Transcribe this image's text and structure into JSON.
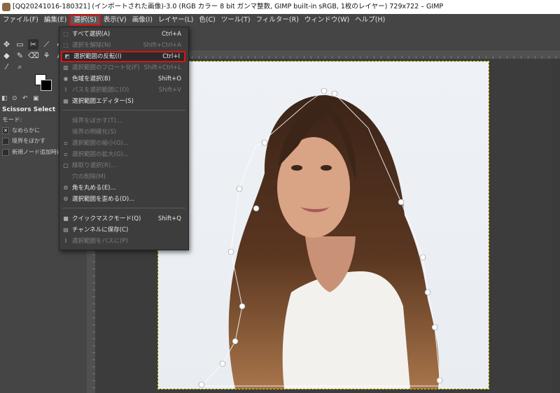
{
  "window": {
    "title": "[QQ20241016-180321] (インポートされた画像)-3.0 (RGB カラー 8 bit ガンマ整数, GIMP built-in sRGB, 1枚のレイヤー) 729x722 – GIMP"
  },
  "menubar": [
    {
      "label": "ファイル(F)"
    },
    {
      "label": "編集(E)"
    },
    {
      "label": "選択(S)"
    },
    {
      "label": "表示(V)"
    },
    {
      "label": "画像(I)"
    },
    {
      "label": "レイヤー(L)"
    },
    {
      "label": "色(C)"
    },
    {
      "label": "ツール(T)"
    },
    {
      "label": "フィルター(R)"
    },
    {
      "label": "ウィンドウ(W)"
    },
    {
      "label": "ヘルプ(H)"
    }
  ],
  "select_menu": {
    "items": [
      {
        "label": "すべて選択(A)",
        "shortcut": "Ctrl+A",
        "enabled": true,
        "icon": "select-all-icon"
      },
      {
        "label": "選択を解除(N)",
        "shortcut": "Shift+Ctrl+A",
        "enabled": false,
        "icon": "select-none-icon"
      },
      {
        "label": "選択範囲の反転(I)",
        "shortcut": "Ctrl+I",
        "enabled": true,
        "highlighted": true,
        "icon": "invert-selection-icon"
      },
      {
        "label": "選択範囲のフロート化(F)",
        "shortcut": "Shift+Ctrl+L",
        "enabled": false,
        "icon": "float-selection-icon"
      },
      {
        "label": "色域を選択(B)",
        "shortcut": "Shift+O",
        "enabled": true,
        "icon": "select-by-color-icon"
      },
      {
        "label": "パスを選択範囲に(O)",
        "shortcut": "Shift+V",
        "enabled": false,
        "icon": "path-to-selection-icon"
      },
      {
        "label": "選択範囲エディター(S)",
        "shortcut": "",
        "enabled": true,
        "icon": "selection-editor-icon"
      },
      {
        "label": "境界をぼかす(T)...",
        "shortcut": "",
        "enabled": false,
        "icon": ""
      },
      {
        "label": "境界の明確化(S)",
        "shortcut": "",
        "enabled": false,
        "icon": ""
      },
      {
        "label": "選択範囲の縮小(G)...",
        "shortcut": "",
        "enabled": false,
        "icon": "shrink-icon"
      },
      {
        "label": "選択範囲の拡大(G)...",
        "shortcut": "",
        "enabled": false,
        "icon": "grow-icon"
      },
      {
        "label": "縁取り選択(R)...",
        "shortcut": "",
        "enabled": false,
        "icon": "border-icon"
      },
      {
        "label": "穴の削除(M)",
        "shortcut": "",
        "enabled": false,
        "icon": ""
      },
      {
        "label": "角を丸める(E)...",
        "shortcut": "",
        "enabled": true,
        "icon": "round-corners-icon"
      },
      {
        "label": "選択範囲を歪める(D)...",
        "shortcut": "",
        "enabled": true,
        "icon": "distort-icon"
      },
      {
        "label": "クイックマスクモード(Q)",
        "shortcut": "Shift+Q",
        "enabled": true,
        "icon": "quick-mask-icon"
      },
      {
        "label": "チャンネルに保存(C)",
        "shortcut": "",
        "enabled": true,
        "icon": "save-channel-icon"
      },
      {
        "label": "選択範囲をパスに(P)",
        "shortcut": "",
        "enabled": false,
        "icon": "selection-to-path-icon"
      }
    ]
  },
  "tool_options": {
    "title": "Scissors Select",
    "mode_label": "モード:",
    "antialias_label": "なめらかに",
    "feather_label": "境界をぼかす",
    "interactive_label": "新規ノード追加時に"
  },
  "colors": {
    "accent_highlight": "#e01010",
    "menu_bg": "#3d3d3d",
    "app_bg": "#454545"
  }
}
